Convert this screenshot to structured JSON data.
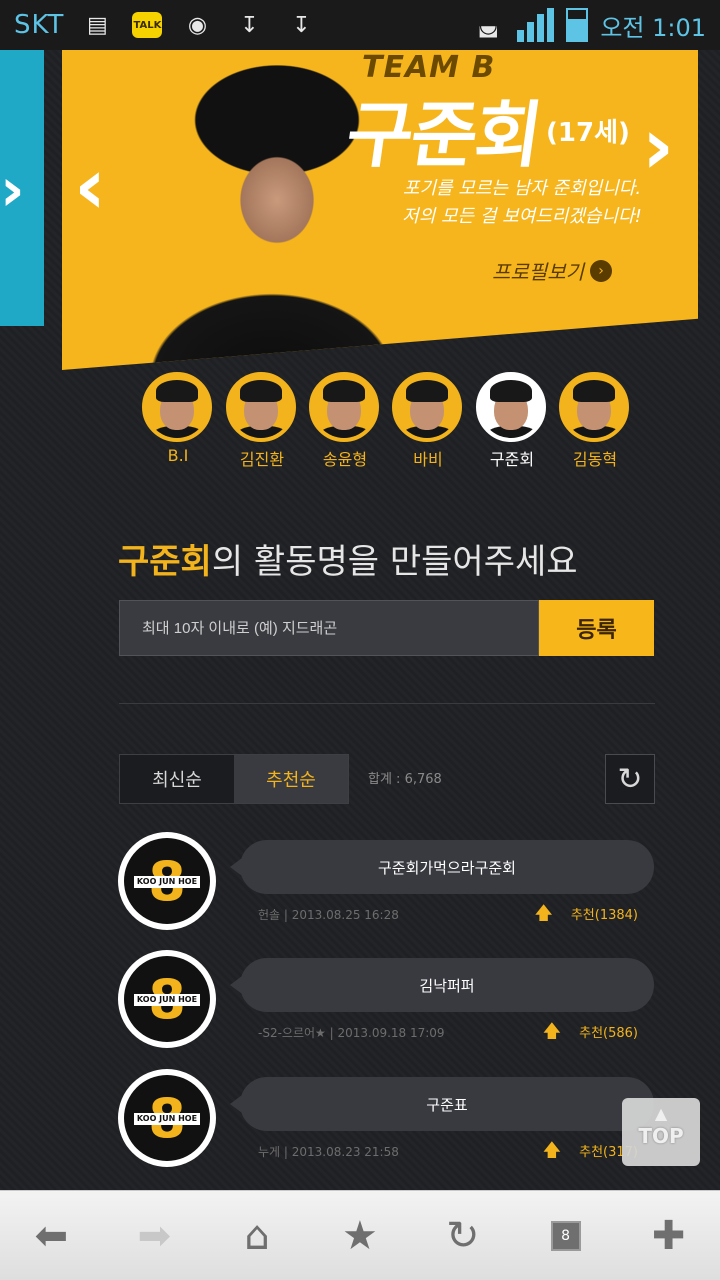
{
  "status": {
    "carrier": "SKT",
    "kakao_label": "TALK",
    "time": "오전 1:01"
  },
  "banner": {
    "team": "TEAM B",
    "name": "구준회",
    "age": "(17세)",
    "tagline_line1": "포기를 모르는 남자 준회입니다.",
    "tagline_line2": "저의 모든 걸 보여드리겠습니다!",
    "profile_link": "프로필보기"
  },
  "members": [
    {
      "name": "B.I"
    },
    {
      "name": "김진환"
    },
    {
      "name": "송윤형"
    },
    {
      "name": "바비"
    },
    {
      "name": "구준회",
      "active": true
    },
    {
      "name": "김동혁"
    }
  ],
  "form": {
    "heading_highlight": "구준회",
    "heading_rest": "의 활동명을 만들어주세요",
    "placeholder": "최대 10자 이내로 (예) 지드래곤",
    "submit_label": "등록"
  },
  "sort": {
    "tab_latest": "최신순",
    "tab_recommended": "추천순",
    "total": "합계 : 6,768"
  },
  "entries": [
    {
      "nickname": "구준회가먹으라구준회",
      "meta": "헌솔  |  2013.08.25 16:28",
      "recommend": "추천(1384)"
    },
    {
      "nickname": "김낙퍼퍼",
      "meta": "-S2-으르어★  |  2013.09.18 17:09",
      "recommend": "추천(586)"
    },
    {
      "nickname": "구준표",
      "meta": "누게  |  2013.08.23 21:58",
      "recommend": "추천(317)"
    }
  ],
  "badge": {
    "number": "8",
    "text": "KOO JUN HOE"
  },
  "top_button": "TOP",
  "browser": {
    "tab_count": "8"
  },
  "colors": {
    "accent": "#f2b31c",
    "rail": "#1fa9c6",
    "background": "#1d1e21"
  }
}
